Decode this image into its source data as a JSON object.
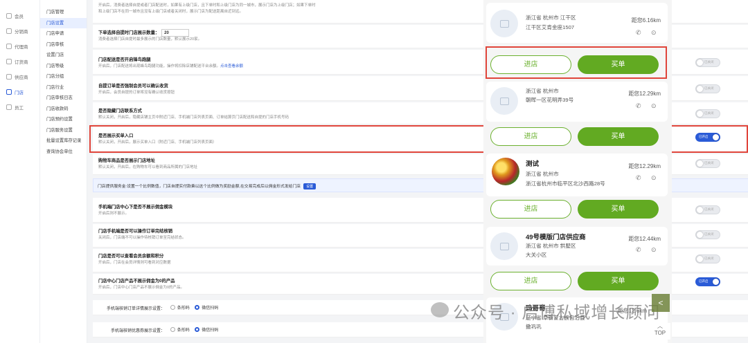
{
  "leftnav": [
    {
      "label": "会员",
      "icon": "person-icon"
    },
    {
      "label": "分销商",
      "icon": "calendar-icon"
    },
    {
      "label": "代理商",
      "icon": "person-icon"
    },
    {
      "label": "订货商",
      "icon": "cart-icon"
    },
    {
      "label": "供应商",
      "icon": "person-icon"
    },
    {
      "label": "门店",
      "icon": "store-icon",
      "active": true
    },
    {
      "label": "员工",
      "icon": "person-icon"
    }
  ],
  "subnav": [
    "门店管理",
    "门店设置",
    "门店申请",
    "门店审核",
    "设置门店",
    "门店等级",
    "门店分组",
    "门店行业",
    "门店审核日志",
    "门店收款码",
    "门店预约设置",
    "门店服务设置",
    "批量设置库存记录",
    "查询协会单位"
  ],
  "settings": {
    "top_desc_1": "开启后，消费者选择自提或者门店配送时，如果有上级门店，且下单时和上级门店为同一城市，展示门店为上级门店；如果下单时",
    "top_desc_2": "和上级门店不在同一城市且没有上级门店或者关闭时，展示门店为配送距离自近到远。",
    "nearby_title": "下单选择自提时门店展示数量：",
    "nearby_value": "20",
    "nearby_desc": "消费者选择门店自提时最多展示的门店数量，默认展示20家。",
    "delivery_title": "门店配送是否开启锋鸟跑腿",
    "delivery_desc": "开启后，门店配送将出现蜂鸟跑腿功能，操作将扣除店铺配送平台余额。",
    "delivery_link": "点击查看余额",
    "force_title": "自提订单是否强制会员可以确认收货",
    "force_desc": "开启后，会员自提的订单将没有确认收货按钮",
    "contact_title": "是否隐藏门店联系方式",
    "contact_desc": "默认关闭，开启后，隐藏店铺主页中附近门店、手机端门店列表页面、订单结算页门店配送和自提的门店手机号码",
    "buy_title": "是否展示买单入口",
    "buy_desc": "默认关闭，开启后，展示买单入口（附近门店、手机端门店列表页面）",
    "address_title": "购物车商品是否展示门店地址",
    "address_desc": "默认关闭，开启后，在购物车可以看到商品所属的门店地址",
    "info_bar": "门店提供服务金:设置一个比例数值，门店自提实付款乘以这个比例做为奖励金额,在交易完成后以佣金形式发给门店",
    "info_btn": "设置",
    "commission_title": "手机端门店中心下是否不展示佣金模块",
    "commission_desc": "开启后则不展示。",
    "verify_title": "门店手机端是否可以操作订单完结核销",
    "verify_desc": "关闭后，门店端不可以操作待核销订单至完结状态。",
    "points_title": "门店是否可以查看会员余额和积分",
    "points_desc": "开启后，门店在会员详情则可看到对应数据",
    "zero_title": "门店中心门店产品不展示佣金为0的产品",
    "zero_desc": "开启后，门店中心门店产品不展示佣金为0的产品。",
    "radio1_label": "手机端核销订单详情展示设置：",
    "radio2_label": "手机端核销优惠券展示设置：",
    "radio_opt1": "条形码",
    "radio_opt2": "微信扫码",
    "toggle_off": "已关闭",
    "toggle_on": "已开启"
  },
  "phone": {
    "stores": [
      {
        "name": "",
        "province": "浙江省 杭州市 江干区",
        "address": "江干区艾肯金座1507",
        "distance": "距您6.16km"
      },
      {
        "name": "",
        "province": "浙江省 杭州市",
        "address": "朝晖一区花明弄39号",
        "distance": "距您12.29km"
      },
      {
        "name": "测试",
        "province": "浙江省 杭州市",
        "address": "浙江省杭州市临平区北沙西路28号",
        "distance": "距您12.29km"
      },
      {
        "name": "49号模版门店供应商",
        "province": "浙江省 杭州市 拱墅区",
        "address": "大关小区",
        "distance": "距您12.44km"
      },
      {
        "name": "玛哥哥",
        "province": "辽宁省 阜新蒙古族自治县",
        "address": "撒巩巩",
        "distance": "距您12.6km"
      }
    ],
    "btn_enter": "进店",
    "btn_buy": "买单",
    "top_label": "TOP",
    "back_label": "<"
  },
  "watermark": "公众号 · 启博私域增长顾问",
  "colors": {
    "accent": "#2a5bd7",
    "green": "#62aa22",
    "highlight": "#e0443a"
  }
}
